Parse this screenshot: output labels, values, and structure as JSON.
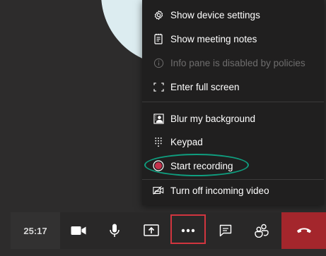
{
  "menu": {
    "items": [
      {
        "label": "Show device settings",
        "icon": "gear-icon",
        "enabled": true
      },
      {
        "label": "Show meeting notes",
        "icon": "notes-icon",
        "enabled": true
      },
      {
        "label": "Info pane is disabled by policies",
        "icon": "info-icon",
        "enabled": false
      },
      {
        "label": "Enter full screen",
        "icon": "fullscreen-icon",
        "enabled": true
      },
      {
        "label": "Blur my background",
        "icon": "blur-background-icon",
        "enabled": true
      },
      {
        "label": "Keypad",
        "icon": "keypad-icon",
        "enabled": true
      },
      {
        "label": "Start recording",
        "icon": "record-icon",
        "enabled": true
      },
      {
        "label": "Turn off incoming video",
        "icon": "video-off-icon",
        "enabled": true
      }
    ]
  },
  "callbar": {
    "timer": "25:17",
    "buttons": [
      "camera-icon",
      "microphone-icon",
      "share-screen-icon",
      "more-options-icon",
      "chat-icon",
      "participants-icon",
      "hang-up-icon"
    ]
  },
  "colors": {
    "background": "#2d2c2c",
    "menu_background": "#201f1f",
    "record_red": "#c4314b",
    "highlight_teal": "#0f9e7f",
    "highlight_red": "#d1353f",
    "hangup_red": "#a4262c"
  }
}
